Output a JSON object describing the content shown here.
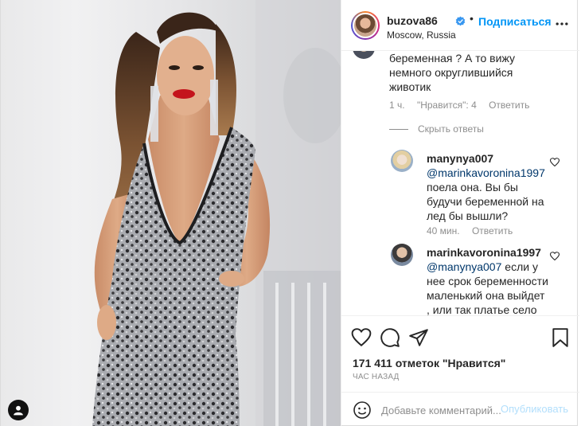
{
  "header": {
    "username": "buzova86",
    "follow_label": "Подписаться",
    "separator": "•",
    "location": "Moscow, Russia"
  },
  "comments": {
    "top_comment": {
      "lines": [
        "беременная ? А то вижу",
        "немного округлившийся",
        "животик"
      ],
      "time": "1 ч.",
      "likes": "\"Нравится\": 4",
      "reply_label": "Ответить"
    },
    "hide_replies_label": "Скрыть ответы",
    "replies": [
      {
        "username": "manynya007",
        "mention": "@marinkavoronina1997",
        "lines": [
          "поела она. Вы бы",
          "будучи беременной на",
          "лед бы вышли?"
        ],
        "time": "40 мин.",
        "reply_label": "Ответить"
      },
      {
        "username": "marinkavoronina1997",
        "mention": "@manynya007",
        "first_line_rest": " если у",
        "lines": [
          "нее срок беременности",
          "маленький она выйдет",
          ", или так платье село"
        ]
      }
    ]
  },
  "actions": {
    "likes_text": "171 411 отметок \"Нравится\"",
    "time_ago": "ЧАС НАЗАД"
  },
  "add_comment": {
    "placeholder": "Добавьте комментарий...",
    "post_label": "Опубликовать"
  },
  "icons": [
    "heart-icon",
    "comment-icon",
    "share-icon",
    "bookmark-icon",
    "more-icon",
    "verified-icon",
    "emoji-icon",
    "user-tag-icon"
  ],
  "colors": {
    "accent": "#0095f6",
    "link": "#00376b",
    "muted": "#8e8e8e",
    "post_disabled": "#b2dffc"
  }
}
